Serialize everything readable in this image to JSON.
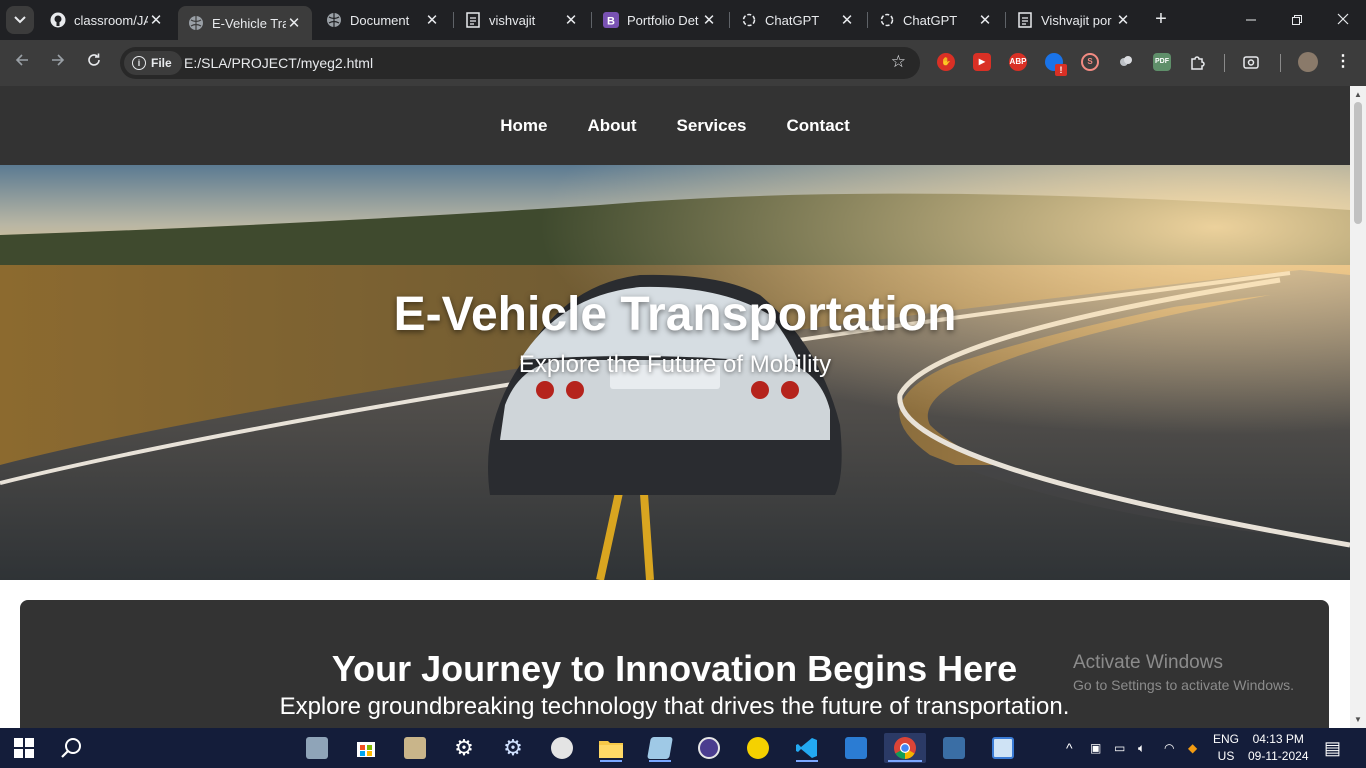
{
  "browser": {
    "tabs": [
      {
        "title": "classroom/JA",
        "icon": "github-icon",
        "active": false
      },
      {
        "title": "E-Vehicle Tra",
        "icon": "globe-icon",
        "active": true
      },
      {
        "title": "Document",
        "icon": "globe-icon",
        "active": false
      },
      {
        "title": "vishvajit",
        "icon": "page-icon",
        "active": false
      },
      {
        "title": "Portfolio Det",
        "icon": "bootstrap-icon",
        "active": false
      },
      {
        "title": "ChatGPT",
        "icon": "chatgpt-icon",
        "active": false
      },
      {
        "title": "ChatGPT",
        "icon": "chatgpt-icon",
        "active": false
      },
      {
        "title": "Vishvajit por",
        "icon": "page-icon",
        "active": false
      }
    ],
    "site_chip_label": "File",
    "url": "E:/SLA/PROJECT/myeg2.html",
    "extensions": [
      "hand-stop-extension-icon",
      "youtube-extension-icon",
      "adblock-plus-extension-icon",
      "extension-with-badge-icon",
      "swirl-extension-icon",
      "cloud-extension-icon",
      "pdf-extension-icon",
      "puzzle-extensions-icon"
    ],
    "ext_labels": {
      "abp": "ABP",
      "pdf": "PDF"
    }
  },
  "site": {
    "nav": [
      "Home",
      "About",
      "Services",
      "Contact"
    ],
    "hero": {
      "title": "E-Vehicle Transportation",
      "subtitle": "Explore the Future of Mobility"
    },
    "card": {
      "heading": "Your Journey to Innovation Begins Here",
      "text": "Explore groundbreaking technology that drives the future of transportation."
    }
  },
  "watermark": {
    "line1": "Activate Windows",
    "line2": "Go to Settings to activate Windows."
  },
  "taskbar": {
    "language": "ENG",
    "region": "US",
    "time": "04:13 PM",
    "date": "09-11-2024"
  }
}
